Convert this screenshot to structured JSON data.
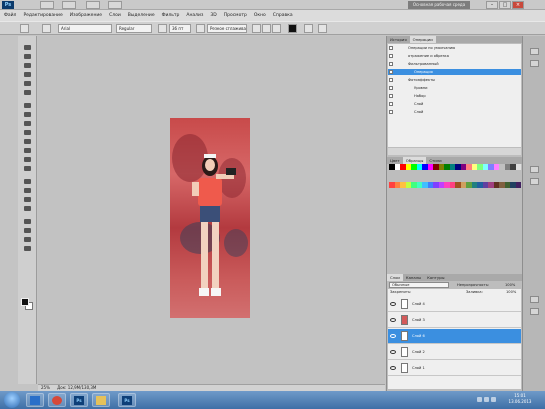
{
  "app": {
    "logo": "Ps",
    "workspace": "Основная рабочая среда"
  },
  "menu": [
    "Файл",
    "Редактирование",
    "Изображение",
    "Слои",
    "Выделение",
    "Фильтр",
    "Анализ",
    "3D",
    "Просмотр",
    "Окно",
    "Справка"
  ],
  "options": {
    "font_family": "Arial",
    "font_style": "Regular",
    "font_size": "36 пт",
    "antialias": "Резкое сглаживание"
  },
  "actions": {
    "tabs": [
      "История",
      "Операции"
    ],
    "items": [
      {
        "label": "Операции по умолчанию",
        "selected": false
      },
      {
        "label": "отражение и обрезка",
        "selected": false
      },
      {
        "label": "Фильтрованный",
        "selected": false
      },
      {
        "label": "Операция",
        "selected": true
      },
      {
        "label": "Фотоэффекты",
        "selected": false
      },
      {
        "label": "Уровни",
        "selected": false
      },
      {
        "label": "Набор",
        "selected": false
      },
      {
        "label": "Слой",
        "selected": false
      },
      {
        "label": "Слой",
        "selected": false
      }
    ]
  },
  "swatches": {
    "tabs": [
      "Цвет",
      "Образцы",
      "Стили"
    ],
    "colors": [
      "#000000",
      "#ffffff",
      "#ff0000",
      "#ffff00",
      "#00ff00",
      "#00ffff",
      "#0000ff",
      "#ff00ff",
      "#7f0000",
      "#7f7f00",
      "#007f00",
      "#007f7f",
      "#00007f",
      "#7f007f",
      "#ff7f7f",
      "#ffff7f",
      "#7fff7f",
      "#7fffff",
      "#7f7fff",
      "#ff7fff",
      "#c0c0c0",
      "#808080",
      "#404040",
      "#e0e0e0",
      "#ff4040",
      "#ff8040",
      "#ffc040",
      "#c0ff40",
      "#40ff80",
      "#40ffc0",
      "#40c0ff",
      "#4080ff",
      "#8040ff",
      "#c040ff",
      "#ff40c0",
      "#ff4080",
      "#a05020",
      "#d0a060",
      "#60a040",
      "#208080",
      "#2060a0",
      "#6040a0",
      "#a04080",
      "#603020",
      "#806040",
      "#406030",
      "#204060",
      "#402060"
    ]
  },
  "layers": {
    "tabs": [
      "Слои",
      "Каналы",
      "Контуры"
    ],
    "blend_mode": "Обычные",
    "opacity_label": "Непрозрачность:",
    "opacity": "100%",
    "fill_label": "Заливка:",
    "fill": "100%",
    "lock_label": "Закрепить:",
    "items": [
      {
        "name": "Слой 4",
        "selected": false
      },
      {
        "name": "Слой 3",
        "selected": false
      },
      {
        "name": "Слой 6",
        "selected": true
      },
      {
        "name": "Слой 2",
        "selected": false
      },
      {
        "name": "Слой 1",
        "selected": false
      }
    ]
  },
  "status": {
    "zoom": "25%",
    "doc": "Док: 12,9M/130,3M"
  },
  "taskbar": {
    "time": "15:01",
    "date": "13.06.2013"
  }
}
